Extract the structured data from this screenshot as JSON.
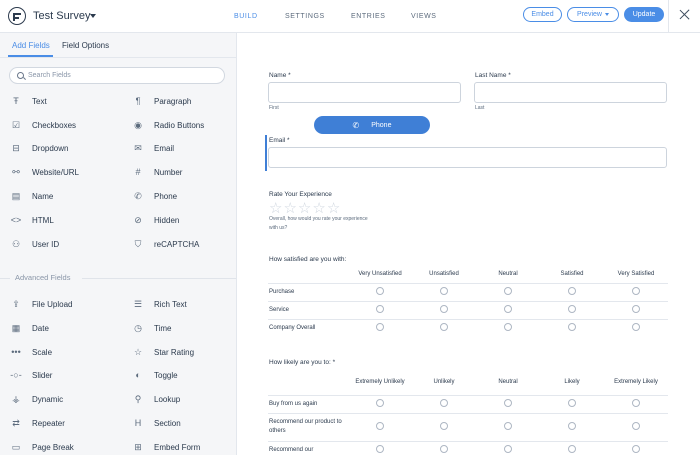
{
  "header": {
    "title": "Test Survey",
    "nav_tabs": [
      "BUILD",
      "SETTINGS",
      "ENTRIES",
      "VIEWS"
    ],
    "embed_label": "Embed",
    "preview_label": "Preview",
    "update_label": "Update"
  },
  "sidebar": {
    "tabs": [
      "Add Fields",
      "Field Options"
    ],
    "search_placeholder": "Search Fields",
    "fields": [
      {
        "label": "Text",
        "icon": "text-icon"
      },
      {
        "label": "Paragraph",
        "icon": "paragraph-icon"
      },
      {
        "label": "Checkboxes",
        "icon": "checkbox-icon"
      },
      {
        "label": "Radio Buttons",
        "icon": "radio-icon"
      },
      {
        "label": "Dropdown",
        "icon": "dropdown-icon"
      },
      {
        "label": "Email",
        "icon": "email-icon"
      },
      {
        "label": "Website/URL",
        "icon": "link-icon"
      },
      {
        "label": "Number",
        "icon": "hash-icon"
      },
      {
        "label": "Name",
        "icon": "name-icon"
      },
      {
        "label": "Phone",
        "icon": "phone-icon"
      },
      {
        "label": "HTML",
        "icon": "code-icon"
      },
      {
        "label": "Hidden",
        "icon": "hidden-icon"
      },
      {
        "label": "User ID",
        "icon": "user-icon"
      },
      {
        "label": "reCAPTCHA",
        "icon": "shield-icon"
      }
    ],
    "advanced_heading": "Advanced Fields",
    "advanced_fields": [
      {
        "label": "File Upload",
        "icon": "upload-icon"
      },
      {
        "label": "Rich Text",
        "icon": "rich-text-icon"
      },
      {
        "label": "Date",
        "icon": "calendar-icon"
      },
      {
        "label": "Time",
        "icon": "clock-icon"
      },
      {
        "label": "Scale",
        "icon": "scale-icon"
      },
      {
        "label": "Star Rating",
        "icon": "star-icon"
      },
      {
        "label": "Slider",
        "icon": "slider-icon"
      },
      {
        "label": "Toggle",
        "icon": "toggle-icon"
      },
      {
        "label": "Dynamic",
        "icon": "dynamic-icon"
      },
      {
        "label": "Lookup",
        "icon": "lookup-icon"
      },
      {
        "label": "Repeater",
        "icon": "repeater-icon"
      },
      {
        "label": "Section",
        "icon": "section-icon"
      },
      {
        "label": "Page Break",
        "icon": "page-break-icon"
      },
      {
        "label": "Embed Form",
        "icon": "embed-form-icon"
      }
    ]
  },
  "form": {
    "name_label": "Name *",
    "first_sub": "First",
    "last_name_label": "Last Name *",
    "last_sub": "Last",
    "phone_pill": "Phone",
    "email_label": "Email *",
    "rate_label": "Rate Your Experience",
    "rate_desc_1": "Overall, how would you rate your experience",
    "rate_desc_2": "with us?",
    "satisfied_label": "How satisfied are you with:",
    "satisfied_columns": [
      "Very Unsatisfied",
      "Unsatisfied",
      "Neutral",
      "Satisfied",
      "Very Satisfied"
    ],
    "satisfied_rows": [
      "Purchase",
      "Service",
      "Company Overall"
    ],
    "likely_label": "How likely are you to: *",
    "likely_columns": [
      "Extremely Unlikely",
      "Unlikely",
      "Neutral",
      "Likely",
      "Extremely Likely"
    ],
    "likely_rows": [
      "Buy from us again",
      "Recommend our product to others",
      "Recommend our"
    ]
  },
  "colors": {
    "accent": "#4a8de6",
    "sidebar_bg": "#f5f6f8",
    "text": "#2b3a4d"
  }
}
